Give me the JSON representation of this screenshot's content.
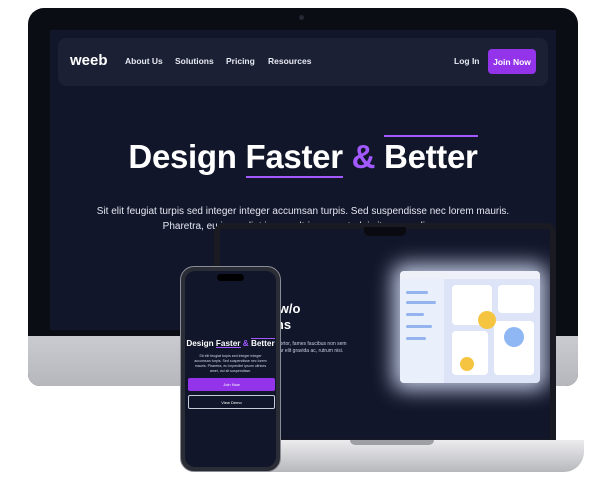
{
  "nav": {
    "logo": "weeb",
    "links": [
      "About Us",
      "Solutions",
      "Pricing",
      "Resources"
    ],
    "login": "Log In",
    "join": "Join Now"
  },
  "hero": {
    "title_part1": "Design ",
    "title_faster": "Faster",
    "title_amp": " & ",
    "title_better": "Better",
    "subtitle": "Sit elit feugiat turpis sed integer integer accumsan turpis. Sed suspendisse nec lorem mauris. Pharetra, eu imperdiet ipsum ultrices amet, dui sit suspendisse."
  },
  "laptop": {
    "heading_line1": "st, w/o",
    "heading_line2": "tions",
    "body": "diam tortor, fames faucibus non sem pulvinar elit gravida ac, rutrum nisi."
  },
  "phone": {
    "title_part1": "Design ",
    "title_faster": "Faster",
    "title_amp": " & ",
    "title_better": "Better",
    "body": "Sit elit feugiat turpis sed integer integer accumsan turpis. Sed suspendisse nec lorem mauris. Pharetra, eu imperdiet ipsum ultrices amet, dui sit suspendisse.",
    "join": "Join Now",
    "demo": "View Demo"
  },
  "colors": {
    "accent": "#9333ea",
    "accent_text": "#a259ff",
    "screen_bg": "#12162b",
    "navbar_bg": "#1b2034"
  }
}
